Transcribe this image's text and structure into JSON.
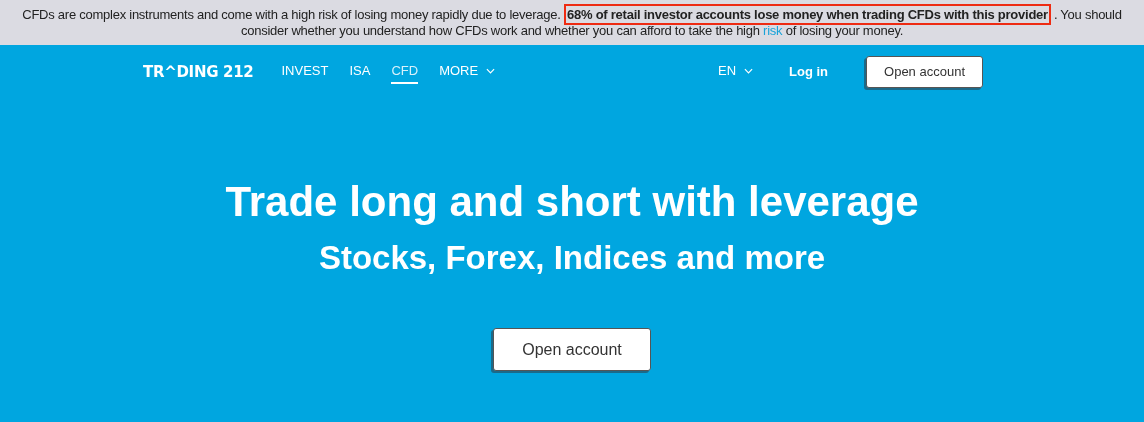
{
  "risk_banner": {
    "text_before": "CFDs are complex instruments and come with a high risk of losing money rapidly due to leverage. **68% of retail investor accounts lose money when trading CFDs with this provider**. You should consider whether you understand how CFDs work and whether you can afford to take the high",
    "link": "risk",
    "text_after": "of losing your money."
  },
  "header": {
    "logo": "TR^DING 212",
    "nav": [
      {
        "label": "INVEST",
        "selected": false
      },
      {
        "label": "ISA",
        "selected": false
      },
      {
        "label": "CFD",
        "selected": true
      },
      {
        "label": "MORE",
        "selected": false,
        "dropdown": true
      }
    ],
    "language": "EN",
    "login": "Log in",
    "open_account": "Open account"
  },
  "hero": {
    "title": "Trade long and short with leverage",
    "subtitle": "Stocks, Forex, Indices and more",
    "button": "Open account"
  }
}
